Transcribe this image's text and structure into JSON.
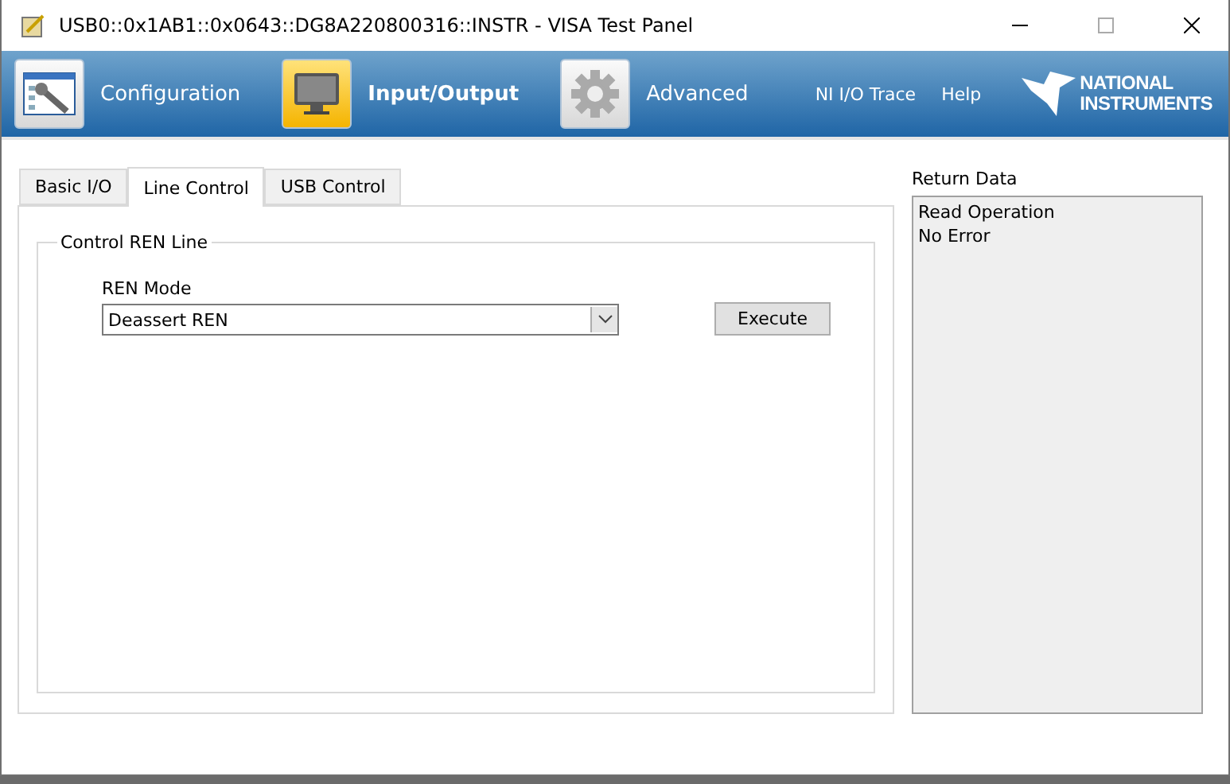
{
  "window": {
    "title": "USB0::0x1AB1::0x0643::DG8A220800316::INSTR - VISA Test Panel"
  },
  "toolbar": {
    "buttons": [
      {
        "kind": "configuration",
        "label": "Configuration",
        "selected": false
      },
      {
        "kind": "io",
        "label": "Input/Output",
        "selected": true
      },
      {
        "kind": "advanced",
        "label": "Advanced",
        "selected": false
      }
    ],
    "links": [
      "NI I/O Trace",
      "Help"
    ],
    "logo": [
      "NATIONAL",
      "INSTRUMENTS"
    ]
  },
  "tabs": [
    {
      "label": "Basic I/O",
      "selected": false
    },
    {
      "label": "Line Control",
      "selected": true
    },
    {
      "label": "USB Control",
      "selected": false
    }
  ],
  "group": {
    "title": "Control REN Line",
    "field_label": "REN Mode",
    "value": "Deassert REN",
    "button": "Execute"
  },
  "return_data": {
    "label": "Return Data",
    "lines": [
      "Read Operation",
      "No Error"
    ]
  }
}
